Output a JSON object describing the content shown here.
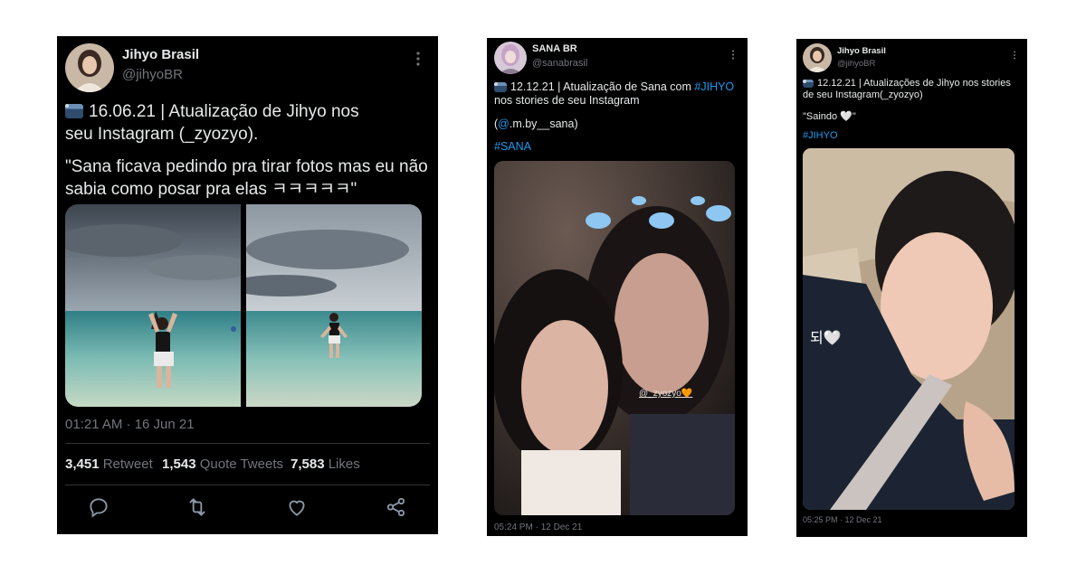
{
  "tweet1": {
    "name": "Jihyo Brasil",
    "handle": "@jihyoBR",
    "line1": "16.06.21 | Atualização de Jihyo nos",
    "line2": "seu Instagram (_zyozyo).",
    "quote_line1": "\"Sana ficava pedindo pra tirar fotos mas eu não",
    "quote_line2": "sabia como posar pra elas ㅋㅋㅋㅋㅋ\"",
    "timestamp": "01:21 AM · 16 Jun 21",
    "retweets_count": "3,451",
    "retweets_label": "Retweet",
    "quotes_count": "1,543",
    "quotes_label": "Quote Tweets",
    "likes_count": "7,583",
    "likes_label": "Likes"
  },
  "tweet2": {
    "name": "SANA BR",
    "handle": "@sanabrasil",
    "line1_text": "12.12.21 | Atualização de Sana com ",
    "line1_tag": "#JIHYO",
    "line2": "nos stories de seu Instagram",
    "mention_open": "(",
    "mention": "@",
    "mention_rest": ".m.by__sana)",
    "hashtag": "#SANA",
    "photo_sticker": "@_zyozyo🧡",
    "timestamp": "05:24 PM · 12 Dec 21"
  },
  "tweet3": {
    "name": "Jihyo Brasil",
    "handle": "@jihyoBR",
    "line1": "12.12.21 | Atualizações de Jihyo nos stories",
    "line2": "de seu Instagram(_zyozyo)",
    "quote": "\"Saindo 🤍\"",
    "hashtag": "#JIHYO",
    "photo_caption": "되🤍",
    "timestamp": "05:25 PM · 12 Dec 21"
  },
  "icons": {
    "reply": "reply-icon",
    "retweet": "retweet-icon",
    "like": "like-icon",
    "share": "share-icon",
    "more": "more-icon",
    "camera": "camera-emoji-icon"
  },
  "colors": {
    "background": "#000000",
    "text": "#e7e9ea",
    "secondary": "#71767b",
    "link": "#1d9bf0"
  }
}
